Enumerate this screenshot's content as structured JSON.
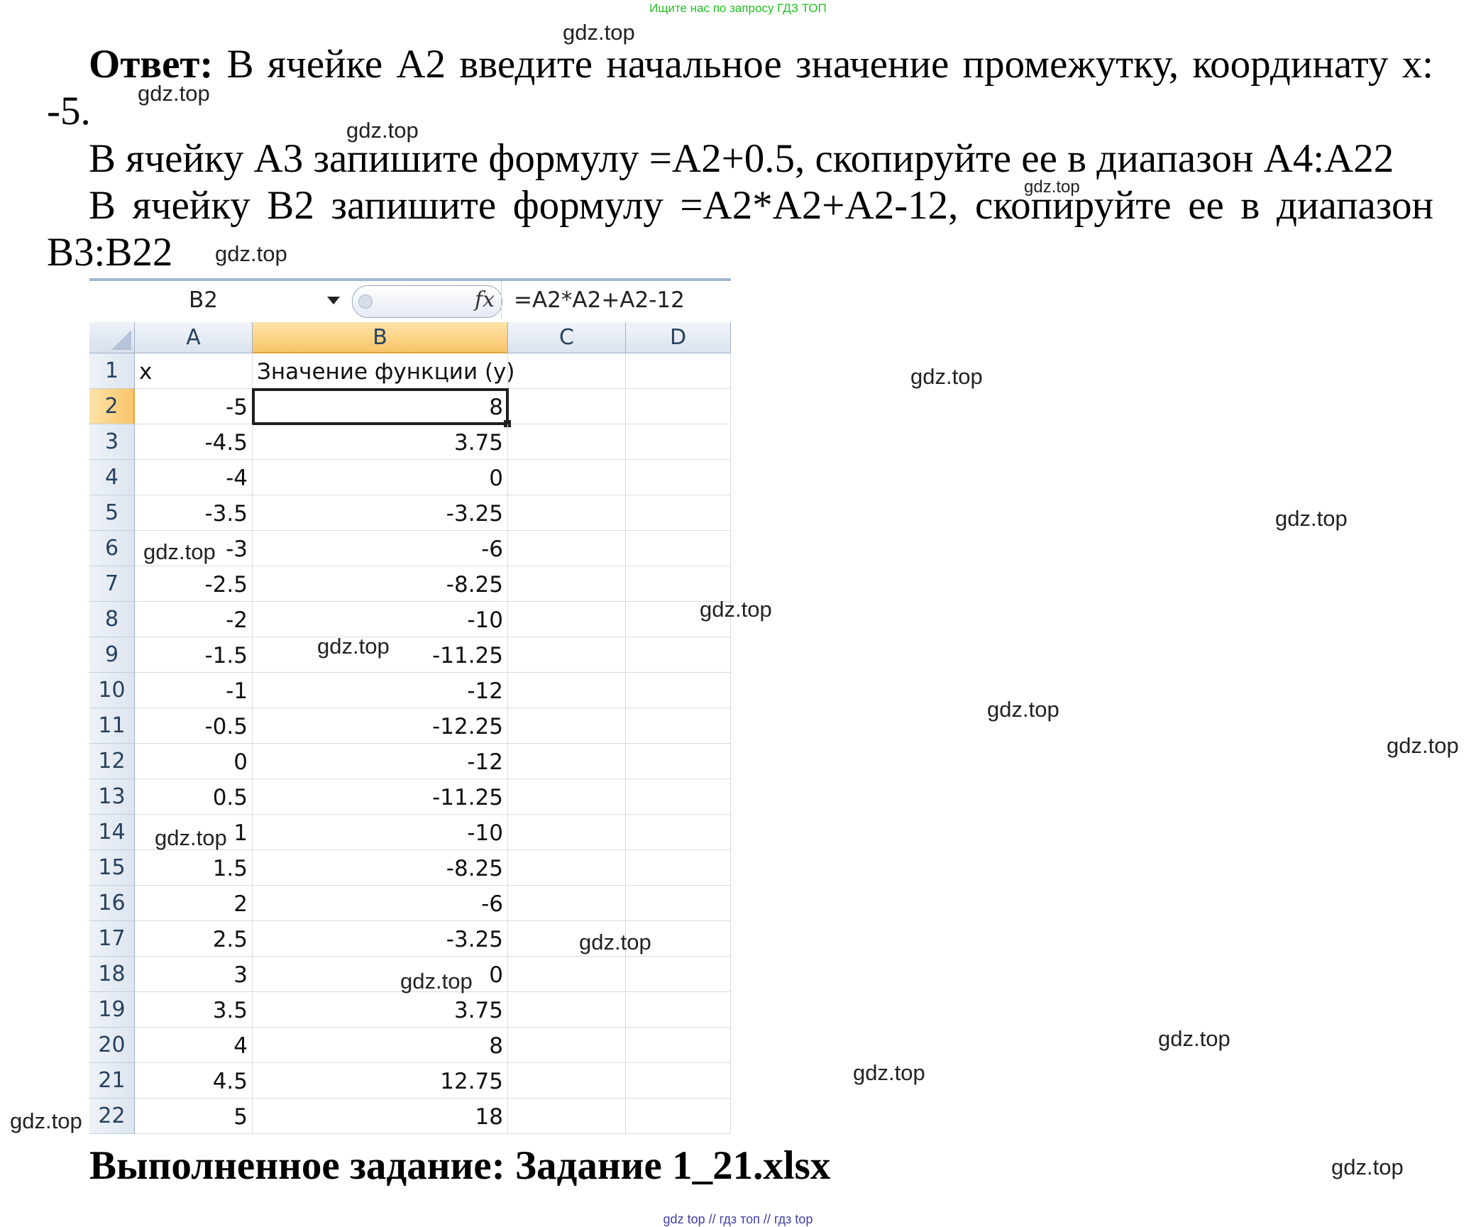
{
  "top_banner": "Ищите нас по запросу ГДЗ ТОП",
  "answer": {
    "label": "Ответ:",
    "line1": " В ячейке А2 введите начальное значение промежутку, координату х: -5.",
    "line2": "В ячейку А3 запишите формулу =A2+0.5, скопируйте ее в диапазон А4:А22",
    "line3": "В ячейку B2 запишите формулу =A2*A2+A2-12, скопируйте ее в диапазон B3:B22"
  },
  "spreadsheet": {
    "name_box": "B2",
    "fx_label": "fx",
    "formula": "=A2*A2+A2-12",
    "columns": [
      "A",
      "B",
      "C",
      "D"
    ],
    "header_row": {
      "row": "1",
      "a": "x",
      "b": "Значение функции (y)"
    },
    "rows": [
      {
        "n": "2",
        "a": "-5",
        "b": "8"
      },
      {
        "n": "3",
        "a": "-4.5",
        "b": "3.75"
      },
      {
        "n": "4",
        "a": "-4",
        "b": "0"
      },
      {
        "n": "5",
        "a": "-3.5",
        "b": "-3.25"
      },
      {
        "n": "6",
        "a": "-3",
        "b": "-6"
      },
      {
        "n": "7",
        "a": "-2.5",
        "b": "-8.25"
      },
      {
        "n": "8",
        "a": "-2",
        "b": "-10"
      },
      {
        "n": "9",
        "a": "-1.5",
        "b": "-11.25"
      },
      {
        "n": "10",
        "a": "-1",
        "b": "-12"
      },
      {
        "n": "11",
        "a": "-0.5",
        "b": "-12.25"
      },
      {
        "n": "12",
        "a": "0",
        "b": "-12"
      },
      {
        "n": "13",
        "a": "0.5",
        "b": "-11.25"
      },
      {
        "n": "14",
        "a": "1",
        "b": "-10"
      },
      {
        "n": "15",
        "a": "1.5",
        "b": "-8.25"
      },
      {
        "n": "16",
        "a": "2",
        "b": "-6"
      },
      {
        "n": "17",
        "a": "2.5",
        "b": "-3.25"
      },
      {
        "n": "18",
        "a": "3",
        "b": "0"
      },
      {
        "n": "19",
        "a": "3.5",
        "b": "3.75"
      },
      {
        "n": "20",
        "a": "4",
        "b": "8"
      },
      {
        "n": "21",
        "a": "4.5",
        "b": "12.75"
      },
      {
        "n": "22",
        "a": "5",
        "b": "18"
      }
    ]
  },
  "completed": "Выполненное задание: Задание 1_21.xlsx",
  "watermark": "gdz.top",
  "footer": "gdz top  //  гдз топ  //  гдз top"
}
